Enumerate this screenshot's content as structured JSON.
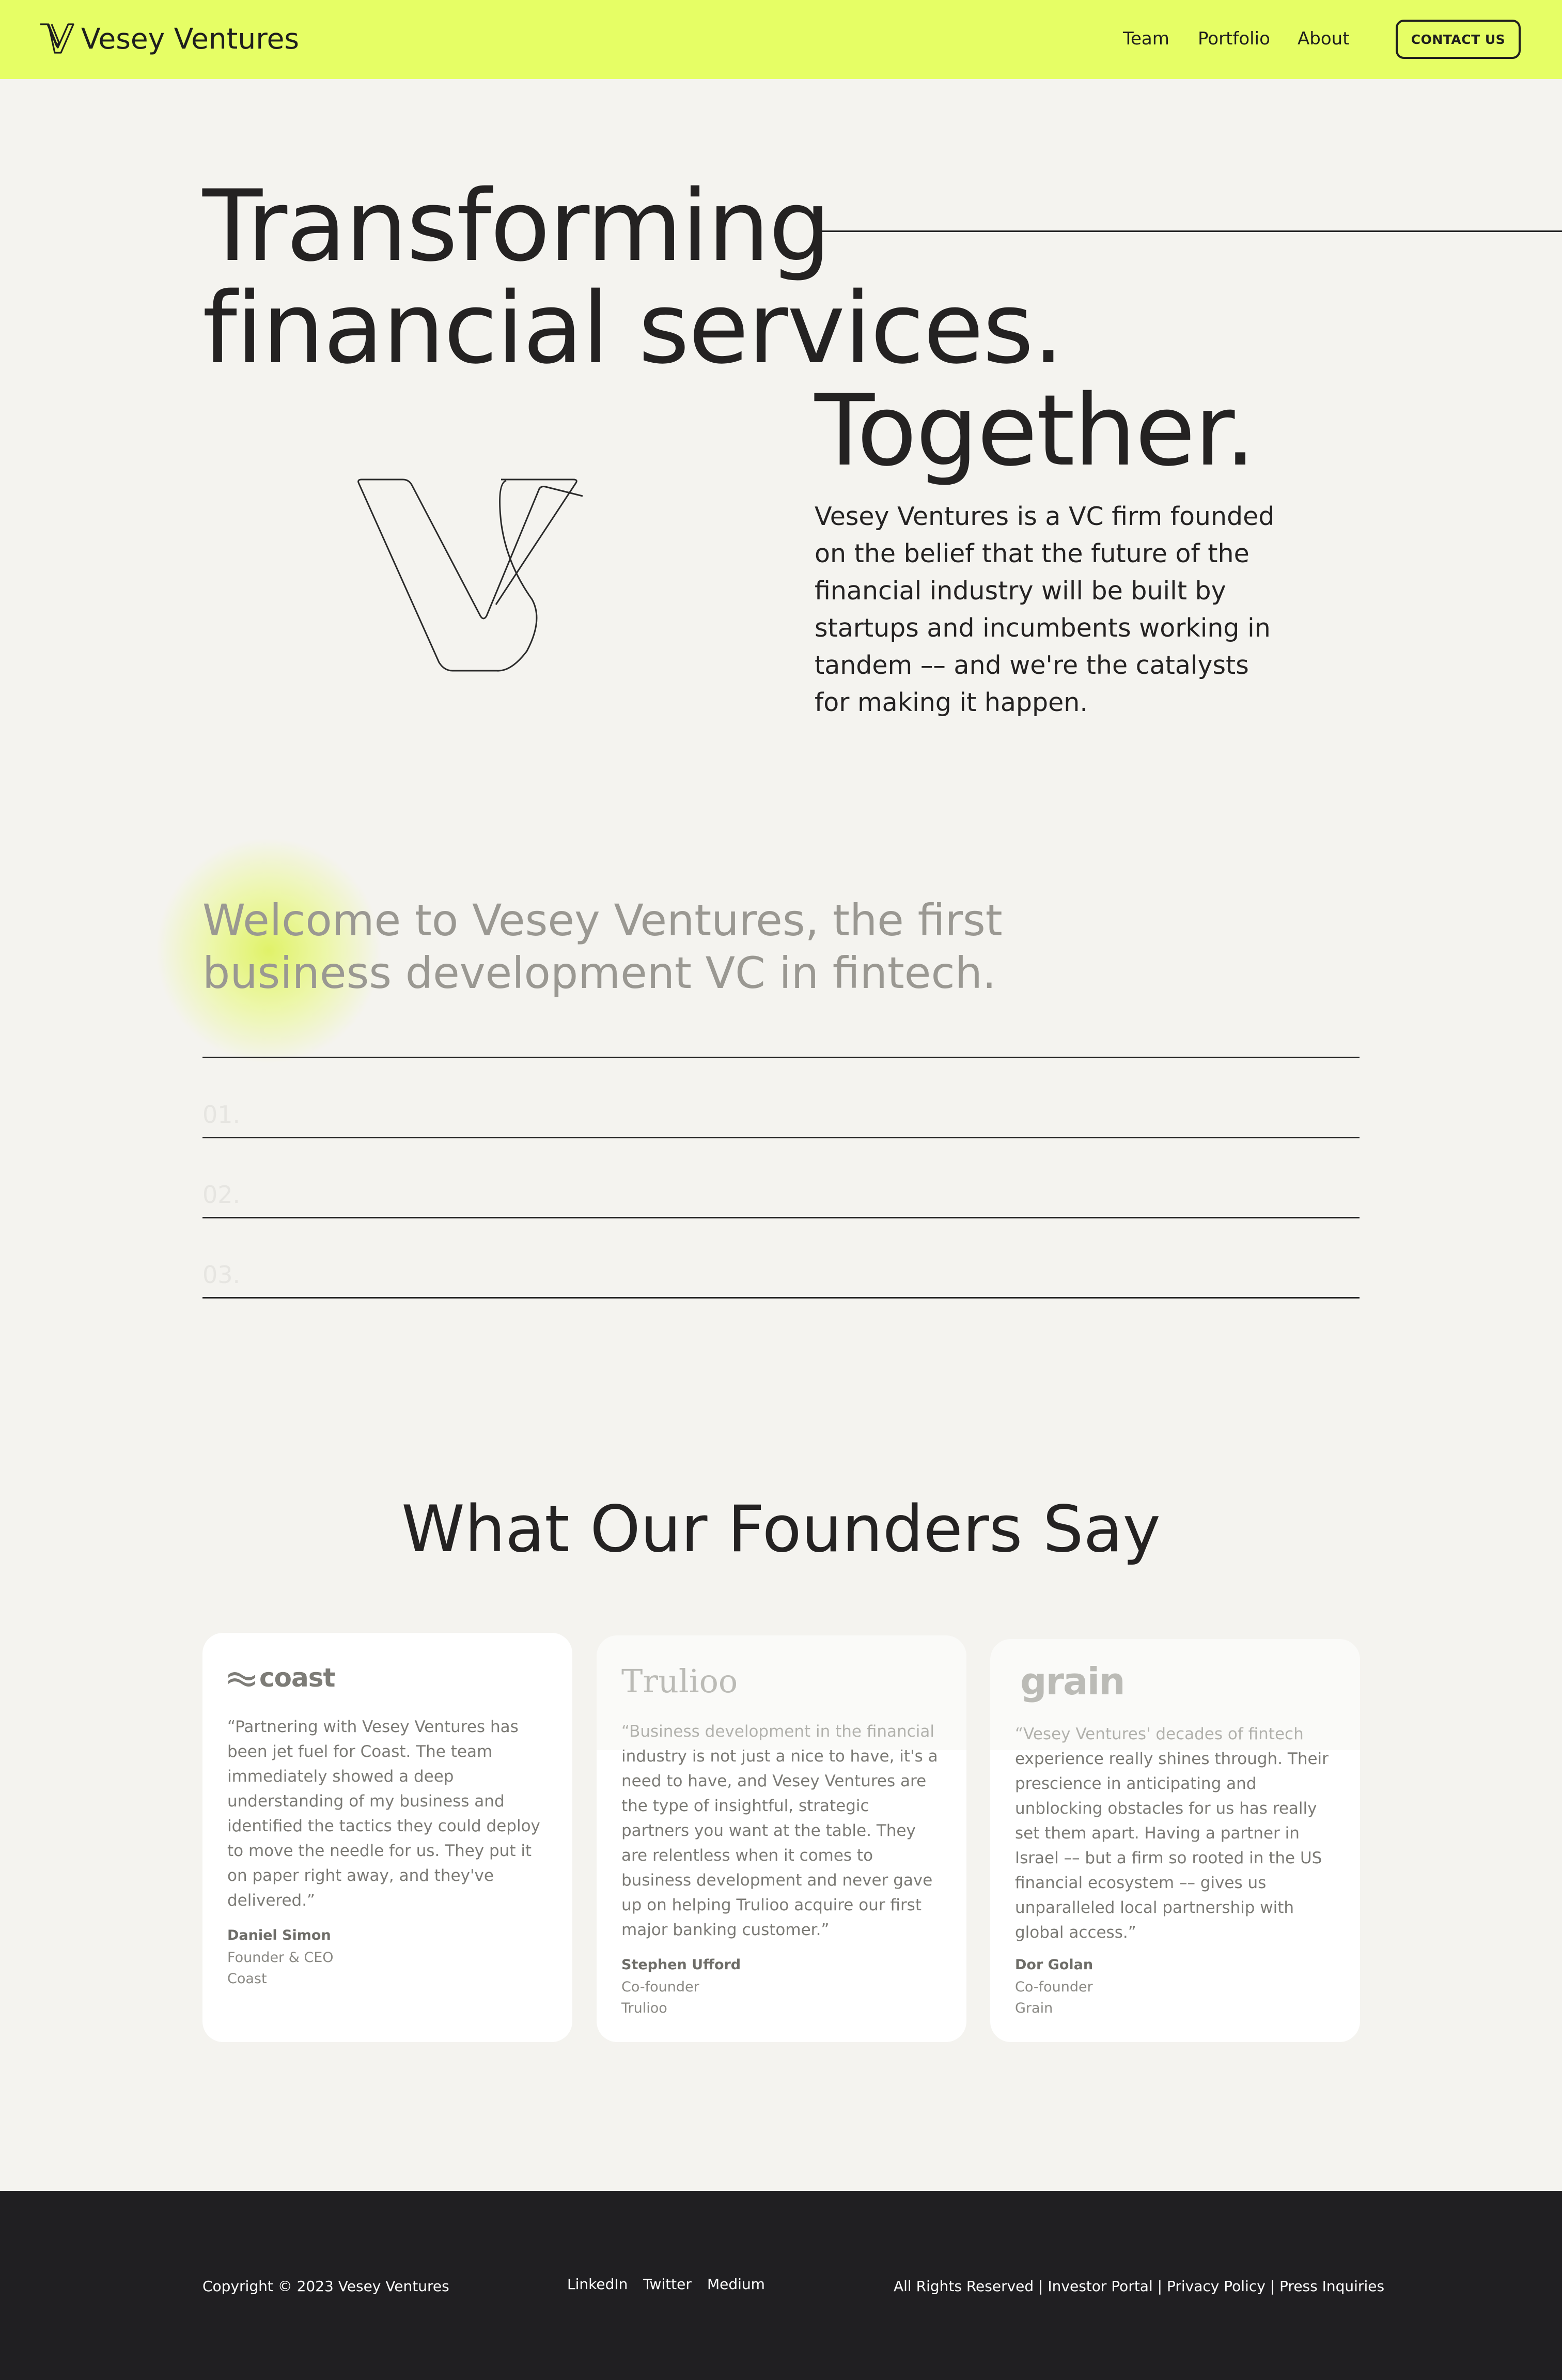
{
  "header": {
    "brand": "Vesey Ventures",
    "logo_icon": "v-logo-icon",
    "nav": [
      "Team",
      "Portfolio",
      "About"
    ],
    "cta": "CONTACT US",
    "accent_color": "#e6fe65"
  },
  "hero": {
    "line1": "Transforming",
    "line2": "financial services.",
    "line3": "Together.",
    "illustration": "v-outline-illustration",
    "description": "Vesey Ventures is a VC firm founded on the belief that the future of the financial industry will be built by startups and incumbents working in tandem –– and we're the catalysts for making it happen."
  },
  "welcome": {
    "heading": "Welcome to Vesey Ventures, the first business development VC in fintech.",
    "items": [
      "01.",
      "02.",
      "03."
    ]
  },
  "testimonials": {
    "title": "What Our Founders Say",
    "cards": [
      {
        "logo": "coast",
        "quote": "“Partnering with Vesey Ventures has been jet fuel for Coast. The team immediately showed a deep understanding of my business and identified the tactics they could deploy to move the needle for us. They put it on paper right away, and they've delivered.”",
        "name": "Daniel Simon",
        "role": "Founder & CEO",
        "company": "Coast"
      },
      {
        "logo": "Trulioo",
        "quote": "“Business development in the financial industry is not just a nice to have, it's a need to have, and Vesey Ventures are the type of insightful, strategic partners you want at the table. They are relentless when it comes to business development and never gave up on helping Trulioo acquire our first major banking customer.”",
        "name": "Stephen Ufford",
        "role": "Co-founder",
        "company": "Trulioo"
      },
      {
        "logo": "grain",
        "quote": "“Vesey Ventures' decades of fintech experience really shines through. Their prescience in anticipating and unblocking obstacles for us has really set them apart. Having a partner in Israel –– but a firm so rooted in the US financial ecosystem –– gives us unparalleled local partnership with global access.”",
        "name": "Dor Golan",
        "role": "Co-founder",
        "company": "Grain"
      }
    ]
  },
  "footer": {
    "copyright": "Copyright © 2023 Vesey Ventures",
    "social": [
      "LinkedIn",
      "Twitter",
      "Medium"
    ],
    "links": "All Rights Reserved | Investor Portal | Privacy Policy | Press Inquiries"
  }
}
